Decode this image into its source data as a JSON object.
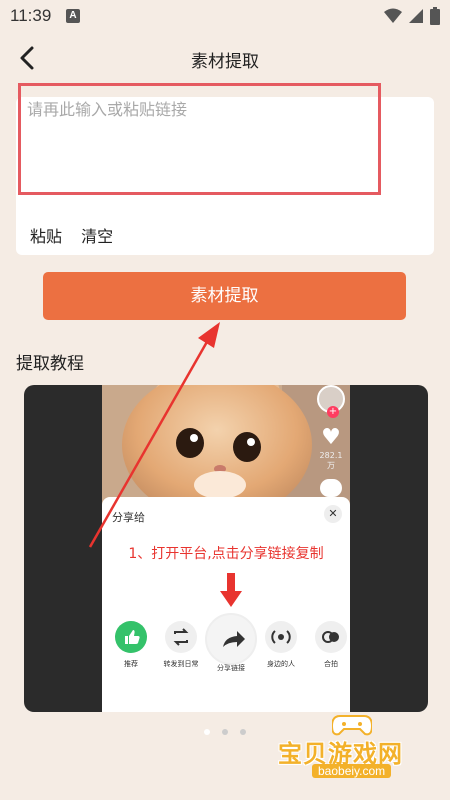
{
  "status_bar": {
    "time": "11:39",
    "notification_icon": "A"
  },
  "header": {
    "title": "素材提取",
    "back_icon": "chevron-left-icon"
  },
  "input_card": {
    "placeholder": "请再此输入或粘贴链接",
    "paste_label": "粘贴",
    "clear_label": "清空",
    "highlight_color": "#e55a60"
  },
  "primary_button": {
    "label": "素材提取",
    "color": "#ec7041"
  },
  "tutorial": {
    "section_title": "提取教程",
    "side_likes": "282.1万",
    "share_sheet_title": "分享给",
    "instruction": "1、打开平台,点击分享链接复制",
    "share_items": [
      "推荐",
      "转发到日常",
      "分享链接",
      "身边的人",
      "合拍"
    ],
    "carousel_pages": 3,
    "carousel_active": 1
  },
  "watermark": {
    "title": "宝贝游戏网",
    "url": "baobeiy.com"
  }
}
